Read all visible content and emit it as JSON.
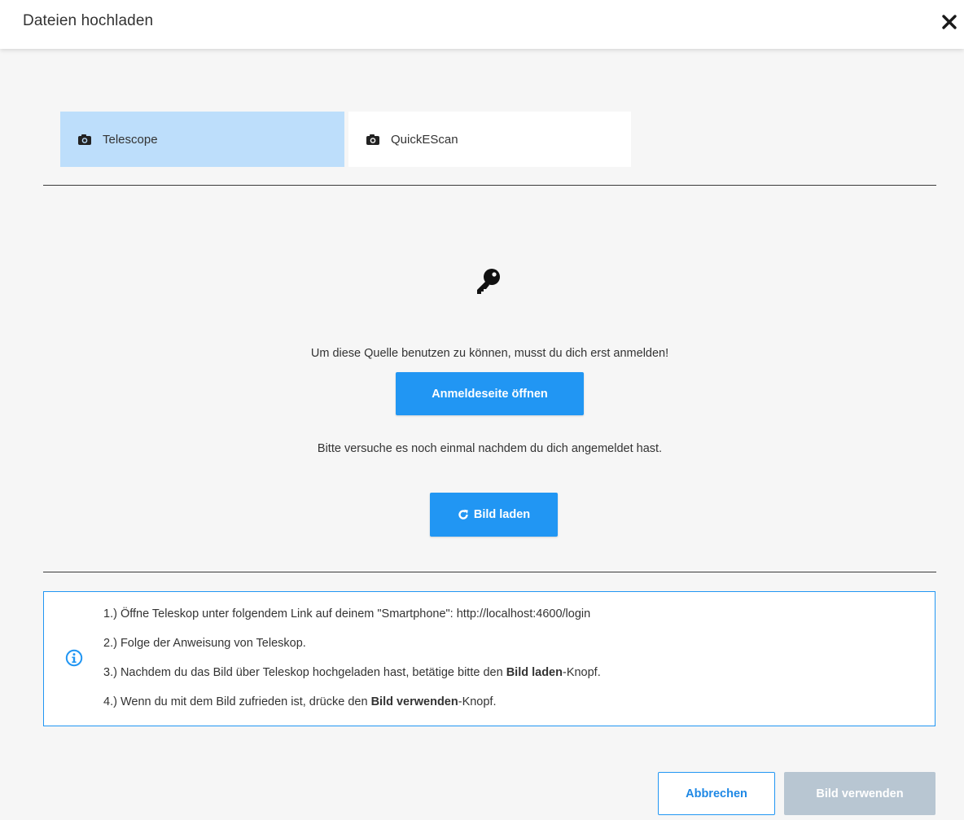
{
  "dialog": {
    "title": "Dateien hochladen",
    "close_icon": "close-icon"
  },
  "tabs": [
    {
      "label": "Telescope",
      "icon": "camera-icon",
      "active": true
    },
    {
      "label": "QuickEScan",
      "icon": "camera-icon",
      "active": false
    }
  ],
  "login_panel": {
    "icon": "key-icon",
    "message": "Um diese Quelle benutzen zu können, musst du dich erst anmelden!",
    "login_button": "Anmeldeseite öffnen",
    "retry_message": "Bitte versuche es noch einmal nachdem du dich angemeldet hast.",
    "reload_button": "Bild laden",
    "reload_icon": "reload-icon"
  },
  "info": {
    "icon": "info-icon",
    "step1": "1.) Öffne Teleskop unter folgendem Link auf deinem \"Smartphone\": http://localhost:4600/login",
    "step2": "2.) Folge der Anweisung von Teleskop.",
    "step3_pre": "3.) Nachdem du das Bild über Teleskop hochgeladen hast, betätige bitte den ",
    "step3_bold": "Bild laden",
    "step3_post": "-Knopf.",
    "step4_pre": "4.) Wenn du mit dem Bild zufrieden ist, drücke den ",
    "step4_bold": "Bild verwenden",
    "step4_post": "-Knopf."
  },
  "footer": {
    "cancel_button": "Abbrechen",
    "use_button": "Bild verwenden",
    "use_button_disabled": true
  },
  "colors": {
    "accent": "#2196f3",
    "active_tab": "#bddefb",
    "disabled_button": "#b8c6d2"
  }
}
